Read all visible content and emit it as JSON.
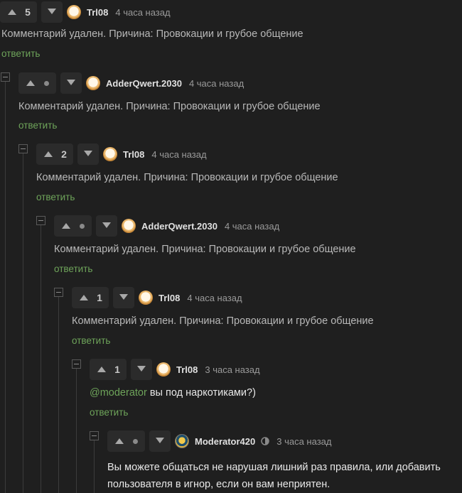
{
  "comments": [
    {
      "score": "5",
      "user": "Trl08",
      "time": "4 часа назад",
      "text": "Комментарий удален. Причина: Провокации и грубое общение",
      "reply": "ответить"
    },
    {
      "score": "",
      "user": "AdderQwert.2030",
      "time": "4 часа назад",
      "text": "Комментарий удален. Причина: Провокации и грубое общение",
      "reply": "ответить"
    },
    {
      "score": "2",
      "user": "Trl08",
      "time": "4 часа назад",
      "text": "Комментарий удален. Причина: Провокации и грубое общение",
      "reply": "ответить"
    },
    {
      "score": "",
      "user": "AdderQwert.2030",
      "time": "4 часа назад",
      "text": "Комментарий удален. Причина: Провокации и грубое общение",
      "reply": "ответить"
    },
    {
      "score": "1",
      "user": "Trl08",
      "time": "4 часа назад",
      "text": "Комментарий удален. Причина: Провокации и грубое общение",
      "reply": "ответить"
    },
    {
      "score": "1",
      "user": "Trl08",
      "time": "3 часа назад",
      "mention": "@moderator",
      "text": " вы под наркотиками?)",
      "reply": "ответить"
    },
    {
      "score": "",
      "user": "Moderator420",
      "time": "3 часа назад",
      "text_line1": "Вы можете общаться не нарушая лишний раз правила, или добавить",
      "text_line2": "пользователя в игнор, если он вам неприятен."
    }
  ],
  "icons": {
    "upvote": "upvote-arrow-icon",
    "downvote": "downvote-arrow-icon",
    "collapse": "collapse-minus-icon",
    "moderator_badge": "moderator-badge-icon"
  },
  "colors": {
    "background": "#1f1f1f",
    "accent_green": "#6ea45a",
    "muted_text": "#b8b8b8"
  }
}
